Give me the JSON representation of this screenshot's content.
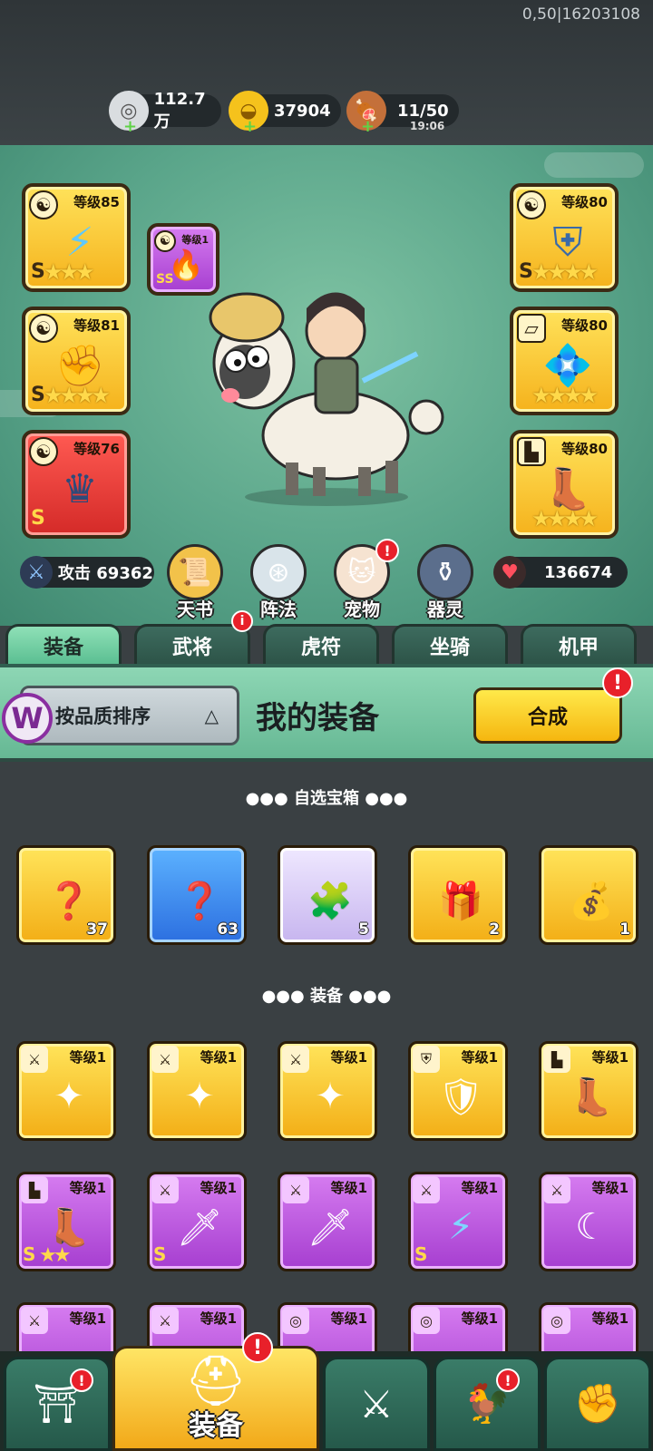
{
  "debug_text": "0,50|16203108",
  "resources": {
    "silver": {
      "value": "112.7万",
      "icon": "silver-coin-icon"
    },
    "gold": {
      "value": "37904",
      "icon": "gold-ingot-icon"
    },
    "stamina": {
      "value": "11/50",
      "timer": "19:06",
      "icon": "meat-icon"
    }
  },
  "equipment_slots": [
    {
      "level": "等级85",
      "grade": "S",
      "stars": 3,
      "icon": "lightning-sword-icon"
    },
    {
      "level": "等级1",
      "grade": "SS",
      "icon": "fire-spirit-icon"
    },
    {
      "level": "等级81",
      "grade": "S",
      "stars": 4,
      "icon": "ice-gauntlet-icon"
    },
    {
      "level": "等级76",
      "grade": "S",
      "icon": "dark-crown-icon"
    },
    {
      "level": "等级80",
      "grade": "S",
      "stars": 4,
      "icon": "frost-armor-icon"
    },
    {
      "level": "等级80",
      "stars": 4,
      "icon": "gem-bracer-icon"
    },
    {
      "level": "等级80",
      "stars": 4,
      "icon": "golden-boots-icon"
    }
  ],
  "stats": {
    "attack": "攻击 69362",
    "hp": "136674"
  },
  "features": [
    {
      "label": "天书",
      "icon": "scroll-icon"
    },
    {
      "label": "阵法",
      "icon": "formation-icon"
    },
    {
      "label": "宠物",
      "icon": "cat-icon",
      "badge": "!"
    },
    {
      "label": "器灵",
      "icon": "spirit-pot-icon"
    }
  ],
  "tabs": [
    {
      "label": "装备",
      "active": true
    },
    {
      "label": "武将",
      "badge": "i"
    },
    {
      "label": "虎符"
    },
    {
      "label": "坐骑"
    },
    {
      "label": "机甲"
    }
  ],
  "panel": {
    "sort_label": "按品质排序",
    "title": "我的装备",
    "compose_label": "合成",
    "compose_badge": "!"
  },
  "sections": {
    "chests": "自选宝箱",
    "equipment": "装备"
  },
  "chest_items": [
    {
      "count": "37",
      "icon": "mystery-chest-icon",
      "rarity": "gold"
    },
    {
      "count": "63",
      "icon": "mystery-chest-icon",
      "rarity": "blue"
    },
    {
      "count": "5",
      "icon": "hero-fragment-icon",
      "rarity": "lilac"
    },
    {
      "count": "2",
      "icon": "puzzle-chest-icon",
      "rarity": "gold"
    },
    {
      "count": "1",
      "icon": "treasure-bag-icon",
      "rarity": "gold"
    }
  ],
  "equip_items": [
    {
      "level": "等级1",
      "icon": "shuriken-icon",
      "rarity": "gold"
    },
    {
      "level": "等级1",
      "icon": "shuriken-icon",
      "rarity": "gold"
    },
    {
      "level": "等级1",
      "icon": "shuriken-icon",
      "rarity": "gold"
    },
    {
      "level": "等级1",
      "icon": "golden-armor-icon",
      "rarity": "gold"
    },
    {
      "level": "等级1",
      "icon": "golden-boots-icon",
      "rarity": "gold"
    },
    {
      "level": "等级1",
      "grade": "S",
      "stars": 2,
      "icon": "dark-boots-icon",
      "rarity": "purple"
    },
    {
      "level": "等级1",
      "grade": "S",
      "icon": "curved-blade-icon",
      "rarity": "purple"
    },
    {
      "level": "等级1",
      "icon": "curved-blade-icon",
      "rarity": "purple"
    },
    {
      "level": "等级1",
      "grade": "S",
      "icon": "lightning-sword-icon",
      "rarity": "purple"
    },
    {
      "level": "等级1",
      "icon": "scimitar-icon",
      "rarity": "purple"
    },
    {
      "level": "等级1",
      "icon": "bow-icon",
      "rarity": "purple"
    },
    {
      "level": "等级1",
      "icon": "weapon-icon",
      "rarity": "purple"
    },
    {
      "level": "等级1",
      "icon": "necklace-icon",
      "rarity": "purple"
    },
    {
      "level": "等级1",
      "icon": "necklace-icon",
      "rarity": "purple"
    },
    {
      "level": "等级1",
      "icon": "necklace-icon",
      "rarity": "purple"
    }
  ],
  "bottom_nav": [
    {
      "icon": "shop-gate-icon",
      "badge": "!"
    },
    {
      "label": "装备",
      "icon": "helmet-icon",
      "badge": "!",
      "active": true
    },
    {
      "icon": "crossed-swords-icon"
    },
    {
      "icon": "rooster-icon",
      "badge": "!"
    },
    {
      "icon": "fist-upgrade-icon"
    }
  ],
  "colors": {
    "gold_slot": "#f5b21c",
    "purple_slot": "#a63ed0",
    "blue_slot": "#2c6fe0",
    "panel_green": "#66b894",
    "badge_red": "#e8202a"
  }
}
